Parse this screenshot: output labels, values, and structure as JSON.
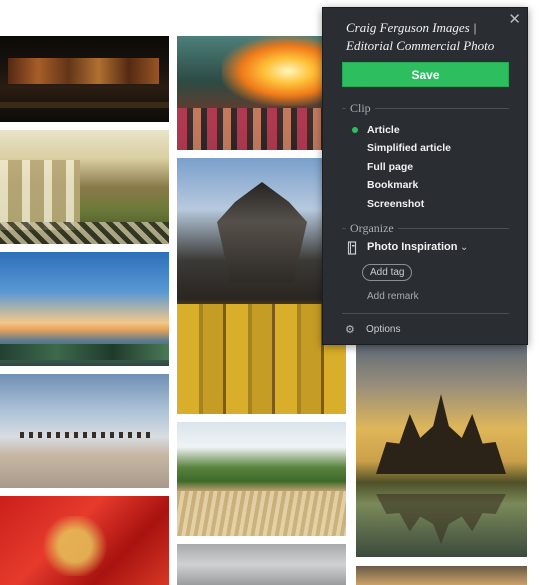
{
  "clipper": {
    "title": "Craig Ferguson Images | Editorial Commercial Photo",
    "close_icon": "close-icon",
    "save_label": "Save",
    "clip_section_label": "Clip",
    "clip_options": [
      "Article",
      "Simplified article",
      "Full page",
      "Bookmark",
      "Screenshot"
    ],
    "selected_clip_option": "Article",
    "organize_section_label": "Organize",
    "notebook_icon": "notebook-icon",
    "notebook_name": "Photo Inspiration",
    "add_tag_label": "Add tag",
    "add_remark_placeholder": "Add remark",
    "options_label": "Options",
    "accent_color": "#2dbe60",
    "panel_color": "#2a2e33"
  }
}
